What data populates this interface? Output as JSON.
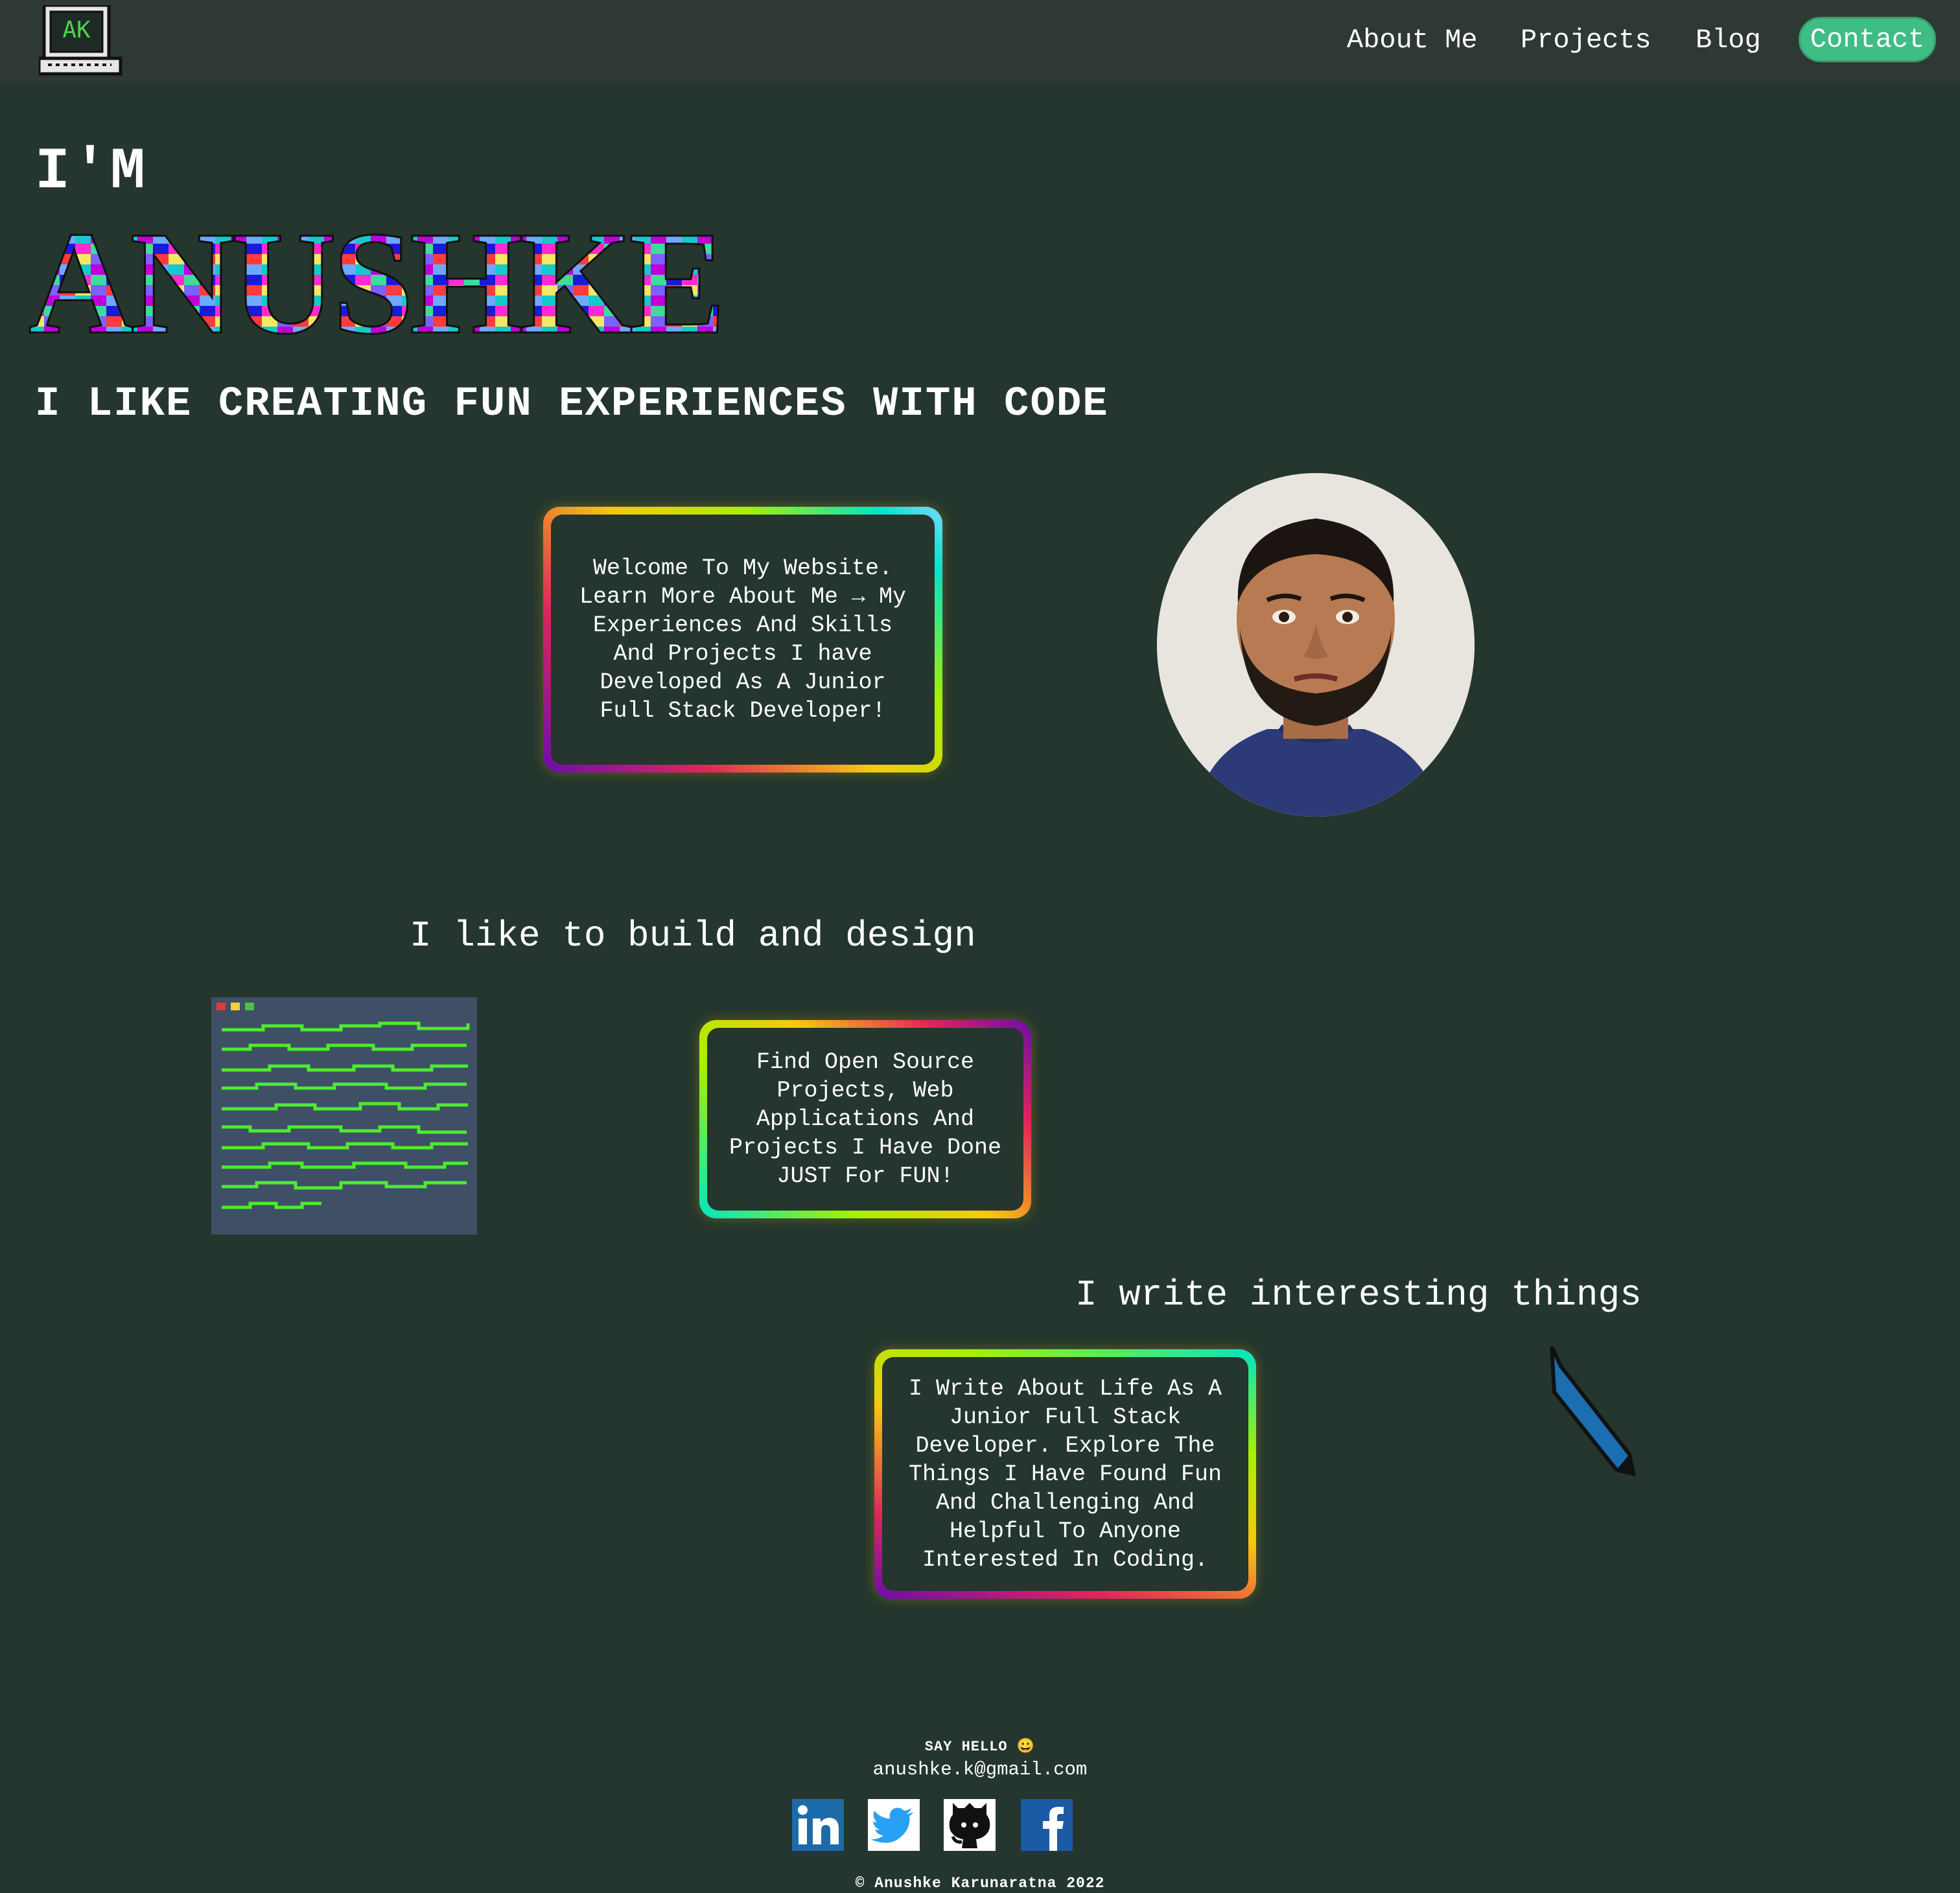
{
  "nav": {
    "logo_text": "AK",
    "about": "About Me",
    "projects": "Projects",
    "blog": "Blog",
    "contact": "Contact"
  },
  "hero": {
    "prefix": "I'M",
    "name": "ANUSHKE",
    "tagline": "I LIKE CREATING FUN EXPERIENCES WITH CODE"
  },
  "cards": {
    "welcome": "Welcome To My Website. Learn More About Me → My Experiences And Skills And Projects I have Developed As A Junior Full Stack Developer!",
    "projects": "Find Open Source Projects, Web Applications And Projects I Have Done JUST For FUN!",
    "blog": "I Write About Life As A Junior Full Stack Developer. Explore The Things I Have Found Fun And Challenging And Helpful To Anyone Interested In Coding."
  },
  "sections": {
    "build": "I like to build and design",
    "write": "I write interesting things"
  },
  "footer": {
    "hello": "SAY HELLO 😀",
    "email": "anushke.k@gmail.com",
    "copyright": "© Anushke Karunaratna 2022"
  },
  "colors": {
    "background": "#24362d",
    "navbar": "#2e3835",
    "contact_button": "#3fbd84",
    "code_window": "#3f4f66",
    "code_lines": "#4cec2e"
  },
  "icons": [
    "laptop-logo-icon",
    "linkedin-icon",
    "twitter-icon",
    "github-icon",
    "facebook-icon",
    "pen-icon"
  ]
}
